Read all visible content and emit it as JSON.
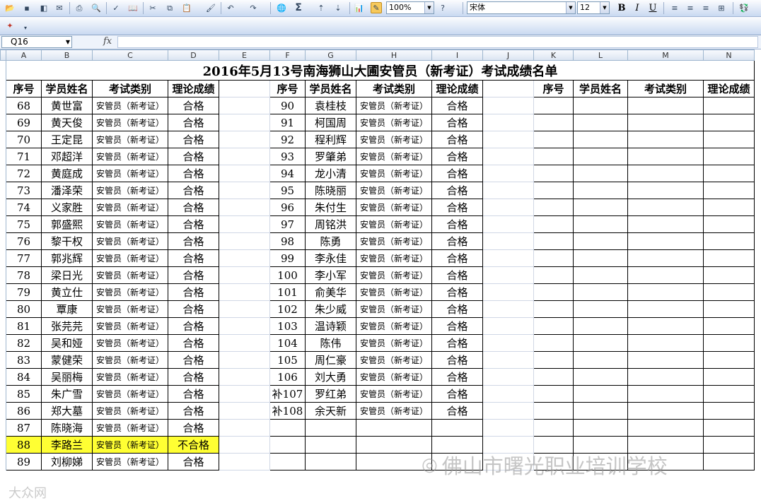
{
  "toolbar": {
    "zoom": "100%",
    "font_name": "宋体",
    "font_size": "12",
    "bold_label": "B",
    "italic_label": "I",
    "underline_label": "U",
    "sum_label": "Σ"
  },
  "formula_bar": {
    "name_box": "Q16",
    "fx_label": "fx",
    "formula": ""
  },
  "columns": [
    "A",
    "B",
    "C",
    "D",
    "E",
    "F",
    "G",
    "H",
    "I",
    "J",
    "K",
    "L",
    "M",
    "N"
  ],
  "sheet": {
    "title": "2016年5月13号南海狮山大圃安管员（新考证）考试成绩名单",
    "headers": [
      "序号",
      "学员姓名",
      "考试类别",
      "理论成绩"
    ],
    "exam_type": "安管员（新考证）",
    "left_block": [
      {
        "no": "68",
        "name": "黄世富",
        "result": "合格"
      },
      {
        "no": "69",
        "name": "黄天俊",
        "result": "合格"
      },
      {
        "no": "70",
        "name": "王定昆",
        "result": "合格"
      },
      {
        "no": "71",
        "name": "邓超洋",
        "result": "合格"
      },
      {
        "no": "72",
        "name": "黄庭成",
        "result": "合格"
      },
      {
        "no": "73",
        "name": "潘泽荣",
        "result": "合格"
      },
      {
        "no": "74",
        "name": "义家胜",
        "result": "合格"
      },
      {
        "no": "75",
        "name": "郭盛熙",
        "result": "合格"
      },
      {
        "no": "76",
        "name": "黎干权",
        "result": "合格"
      },
      {
        "no": "77",
        "name": "郭兆辉",
        "result": "合格"
      },
      {
        "no": "78",
        "name": "梁日光",
        "result": "合格"
      },
      {
        "no": "79",
        "name": "黄立仕",
        "result": "合格"
      },
      {
        "no": "80",
        "name": "覃康",
        "result": "合格"
      },
      {
        "no": "81",
        "name": "张芫芫",
        "result": "合格"
      },
      {
        "no": "82",
        "name": "吴和娅",
        "result": "合格"
      },
      {
        "no": "83",
        "name": "蒙健荣",
        "result": "合格"
      },
      {
        "no": "84",
        "name": "吴丽梅",
        "result": "合格"
      },
      {
        "no": "85",
        "name": "朱广雪",
        "result": "合格"
      },
      {
        "no": "86",
        "name": "郑大墓",
        "result": "合格"
      },
      {
        "no": "87",
        "name": "陈晓海",
        "result": "合格"
      },
      {
        "no": "88",
        "name": "李路兰",
        "result": "不合格"
      },
      {
        "no": "89",
        "name": "刘柳娣",
        "result": "合格"
      }
    ],
    "highlight_row_no": "88",
    "middle_block": [
      {
        "no": "90",
        "name": "袁桂枝",
        "result": "合格"
      },
      {
        "no": "91",
        "name": "柯国周",
        "result": "合格"
      },
      {
        "no": "92",
        "name": "程利辉",
        "result": "合格"
      },
      {
        "no": "93",
        "name": "罗肇弟",
        "result": "合格"
      },
      {
        "no": "94",
        "name": "龙小清",
        "result": "合格"
      },
      {
        "no": "95",
        "name": "陈晓丽",
        "result": "合格"
      },
      {
        "no": "96",
        "name": "朱付生",
        "result": "合格"
      },
      {
        "no": "97",
        "name": "周铭洪",
        "result": "合格"
      },
      {
        "no": "98",
        "name": "陈勇",
        "result": "合格"
      },
      {
        "no": "99",
        "name": "李永佳",
        "result": "合格"
      },
      {
        "no": "100",
        "name": "李小军",
        "result": "合格"
      },
      {
        "no": "101",
        "name": "俞美华",
        "result": "合格"
      },
      {
        "no": "102",
        "name": "朱少威",
        "result": "合格"
      },
      {
        "no": "103",
        "name": "温诗颖",
        "result": "合格"
      },
      {
        "no": "104",
        "name": "陈伟",
        "result": "合格"
      },
      {
        "no": "105",
        "name": "周仁豪",
        "result": "合格"
      },
      {
        "no": "106",
        "name": "刘大勇",
        "result": "合格"
      },
      {
        "no": "补107",
        "name": "罗红弟",
        "result": "合格"
      },
      {
        "no": "补108",
        "name": "余天新",
        "result": "合格"
      }
    ]
  },
  "watermark": {
    "text": "佛山市曙光职业培训学校",
    "icon": "wechat-icon",
    "corner_text": "大众网"
  },
  "colors": {
    "highlight": "#ffff33",
    "toolbar": "#c9d9f1"
  }
}
